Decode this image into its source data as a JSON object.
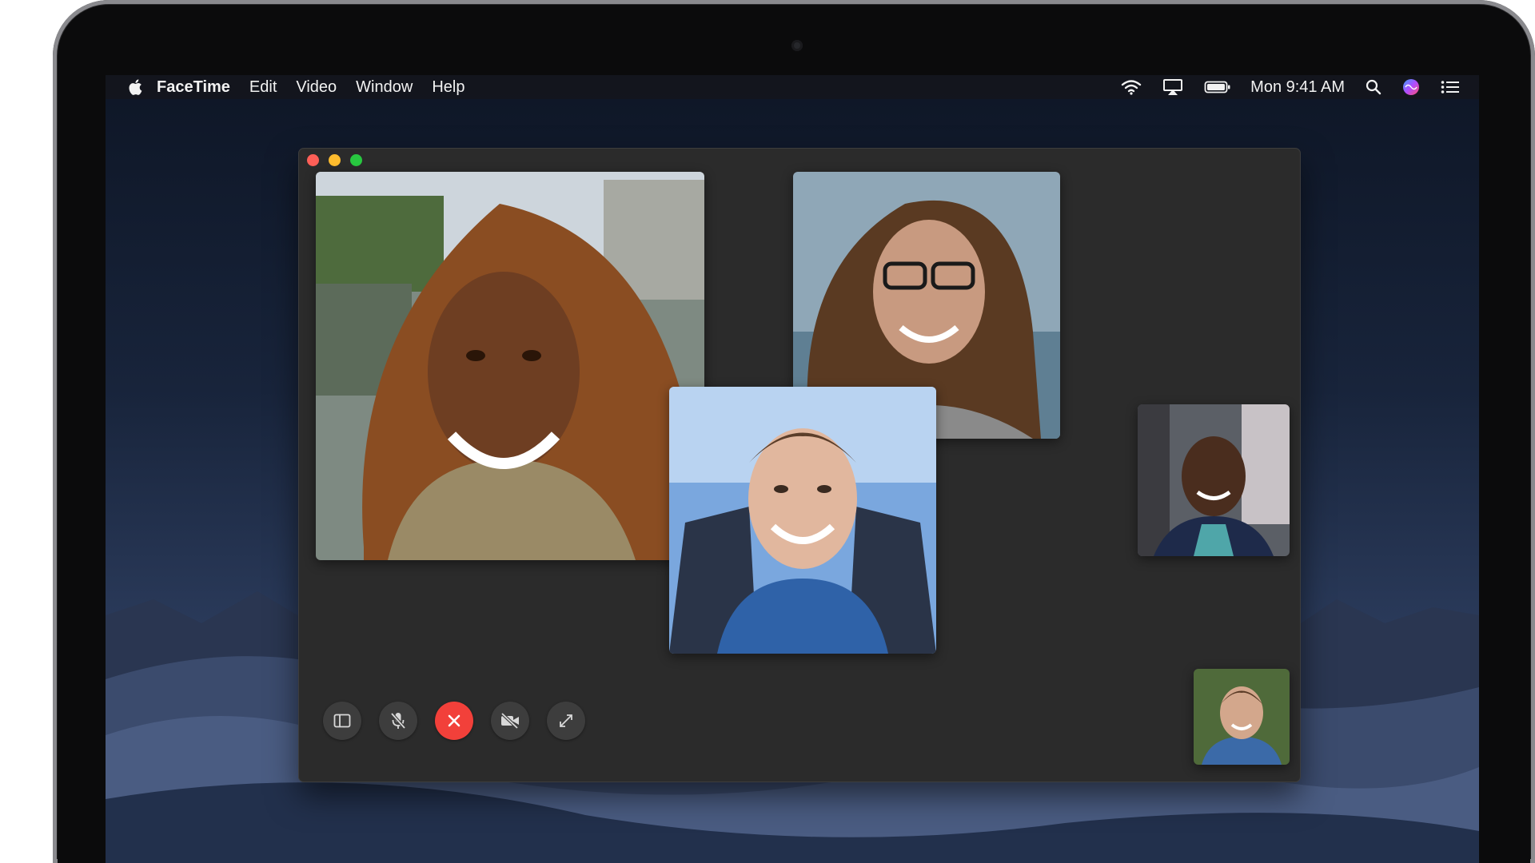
{
  "menubar": {
    "app_name": "FaceTime",
    "menus": [
      "Edit",
      "Video",
      "Window",
      "Help"
    ],
    "clock": "Mon 9:41 AM",
    "status_icons": [
      "wifi-icon",
      "airplay-icon",
      "battery-icon",
      "search-icon",
      "siri-icon",
      "notification-center-icon"
    ]
  },
  "window": {
    "title_buttons": [
      "close",
      "minimize",
      "zoom"
    ],
    "participants": [
      {
        "id": "woman-curly-hair",
        "role": "large-tile"
      },
      {
        "id": "woman-glasses",
        "role": "tile"
      },
      {
        "id": "young-man",
        "role": "tile"
      },
      {
        "id": "man-smiling",
        "role": "small-tile"
      },
      {
        "id": "self-view",
        "role": "self-view"
      }
    ],
    "controls": [
      {
        "name": "sidebar",
        "icon": "sidebar-icon"
      },
      {
        "name": "mute",
        "icon": "microphone-slash-icon"
      },
      {
        "name": "end-call",
        "icon": "close-icon",
        "color": "#f2403a"
      },
      {
        "name": "camera-off",
        "icon": "video-slash-icon"
      },
      {
        "name": "fullscreen",
        "icon": "expand-icon"
      }
    ]
  }
}
